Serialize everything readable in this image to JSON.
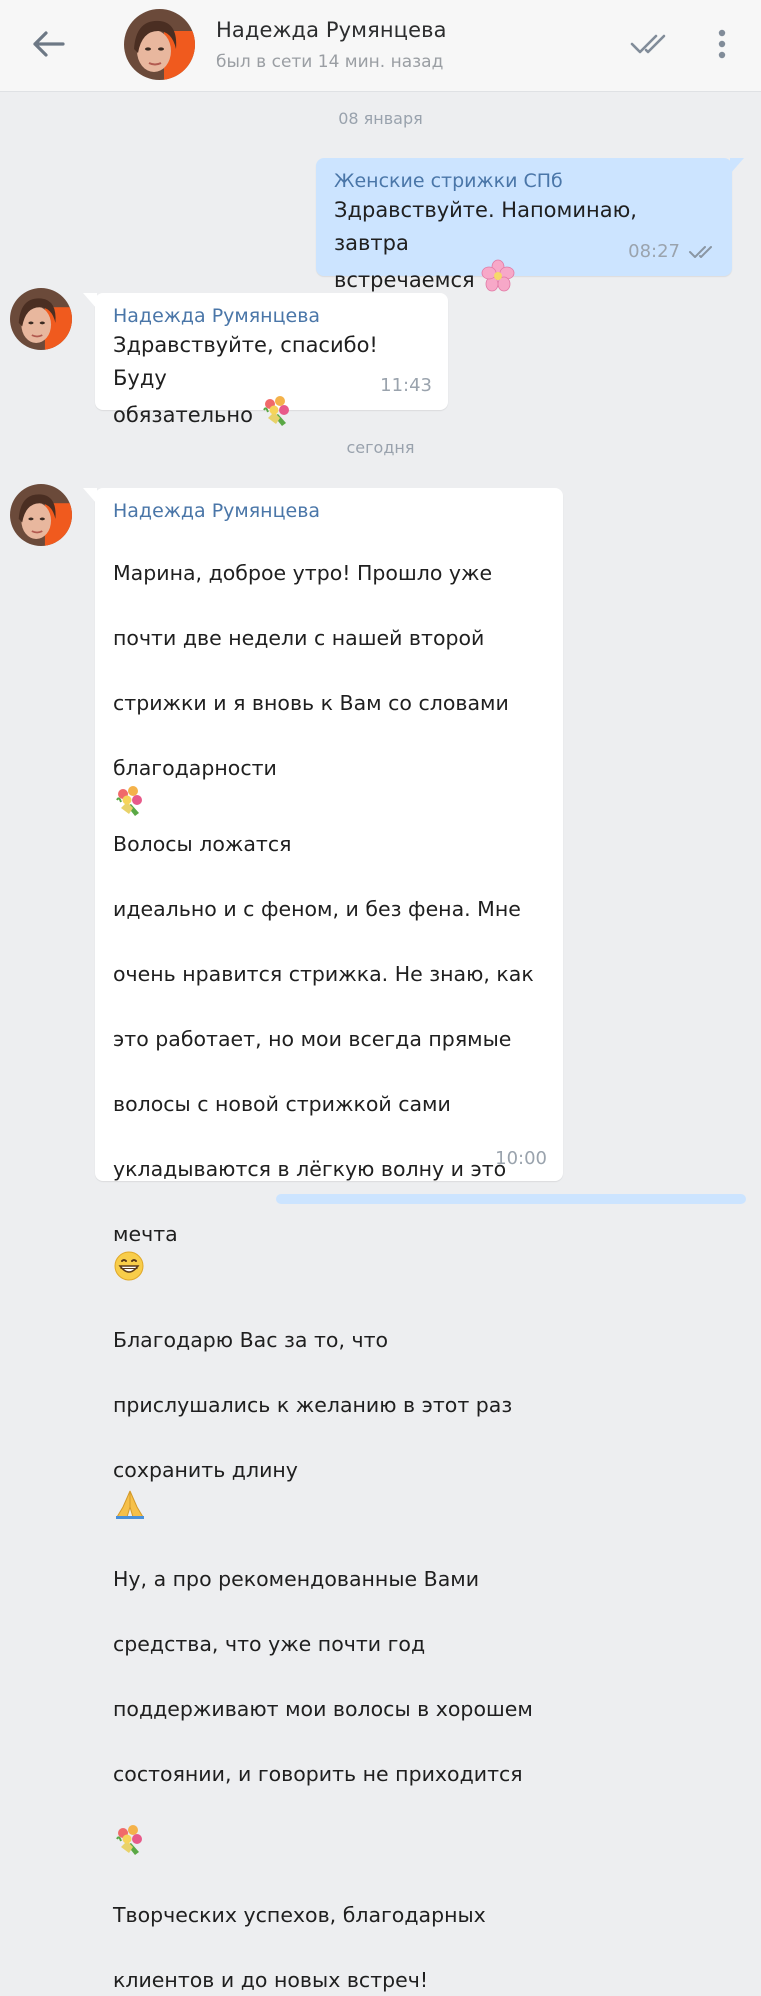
{
  "header": {
    "contact_name": "Надежда Румянцева",
    "status": "был в сети 14 мин. назад",
    "back_icon": "arrow-left-icon",
    "read_icon": "double-check-icon",
    "more_icon": "more-vertical-icon"
  },
  "dates": {
    "first": "08 января",
    "second": "сегодня"
  },
  "messages": [
    {
      "direction": "out",
      "sender": "Женские стрижки СПб",
      "lines": [
        "Здравствуйте. Напоминаю, завтра",
        "встречаемся"
      ],
      "emoji": "cherry-blossom",
      "time": "08:27",
      "status_icon": "double-check-icon"
    },
    {
      "direction": "in",
      "sender": "Надежда Румянцева",
      "lines": [
        "Здравствуйте, спасибо! Буду",
        "обязательно"
      ],
      "emoji": "bouquet",
      "time": "11:43"
    },
    {
      "direction": "in",
      "sender": "Надежда Румянцева",
      "p1": [
        "Марина, доброе утро! Прошло уже",
        "почти две недели с нашей второй",
        "стрижки и я вновь к Вам со словами",
        "благодарности"
      ],
      "p1b": "Волосы ложатся",
      "p2": [
        "идеально и с феном, и без фена. Мне",
        "очень нравится стрижка. Не знаю, как",
        "это работает, но мои всегда прямые",
        "волосы с новой стрижкой сами",
        "укладываются в лёгкую волну и это",
        "мечта"
      ],
      "p3": [
        "Благодарю Вас за то, что",
        "прислушались к желанию в этот раз",
        "сохранить длину"
      ],
      "p4": [
        "Ну, а про рекомендованные Вами",
        "средства, что уже почти год",
        "поддерживают мои волосы в хорошем",
        "состоянии, и говорить не приходится"
      ],
      "p5": [
        "Творческих успехов, благодарных",
        "клиентов и до новых встреч!"
      ],
      "time": "10:00"
    }
  ],
  "colors": {
    "background": "#edeef0",
    "outgoing_bubble": "#cce4ff",
    "incoming_bubble": "#ffffff",
    "sender_name": "#4a76a8"
  }
}
